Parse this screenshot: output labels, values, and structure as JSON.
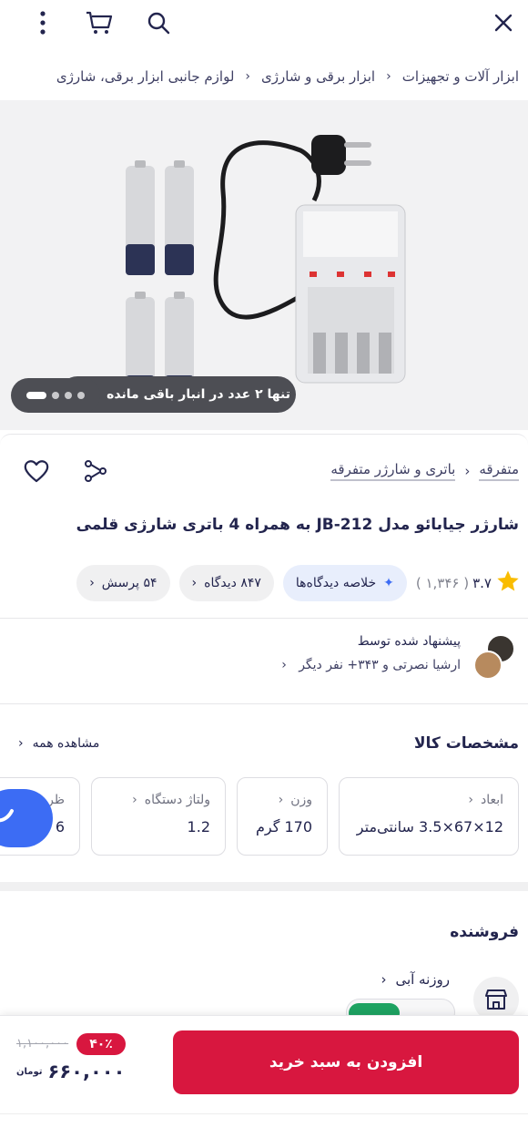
{
  "breadcrumb": [
    "ابزار آلات و تجهیزات",
    "ابزار برقی و شارژی",
    "لوازم جانبی ابزار برقی، شارژی"
  ],
  "stock_text": "تنها ۲ عدد در انبار باقی مانده",
  "category": [
    "متفرقه",
    "باتری و شارژر متفرقه"
  ],
  "title": "شارژر جیابائو مدل JB-212 به همراه 4 باتری شارژی قلمی",
  "rating": {
    "score": "۳.۷",
    "count": "( ۱,۳۴۶ )"
  },
  "chips": {
    "summary": "خلاصه دیدگاه‌ها",
    "views": "۸۴۷ دیدگاه",
    "questions": "۵۴ پرسش"
  },
  "suggest": {
    "label": "پیشنهاد شده توسط",
    "names": "ارشیا نصرتی و ۳۴۳+ نفر دیگر"
  },
  "specs": {
    "heading": "مشخصات کالا",
    "see_all": "مشاهده همه",
    "items": [
      {
        "label": "ابعاد",
        "value": "12×67×3.5 سانتی‌متر"
      },
      {
        "label": "وزن",
        "value": "170 گرم"
      },
      {
        "label": "ولتاژ دستگاه",
        "value": "1.2"
      },
      {
        "label": "ظر",
        "value": "6"
      }
    ]
  },
  "seller": {
    "heading": "فروشنده",
    "name": "روزنه آبی"
  },
  "buy": {
    "label": "افزودن به سبد خرید",
    "discount": "۴۰٪",
    "old_price": "۱,۱۰۰,۰۰۰",
    "price": "۶۶۰,۰۰۰",
    "currency": "تومان"
  },
  "colors": {
    "accent": "#d8173f",
    "blue": "#3c6cf4",
    "green": "#1ea362"
  }
}
